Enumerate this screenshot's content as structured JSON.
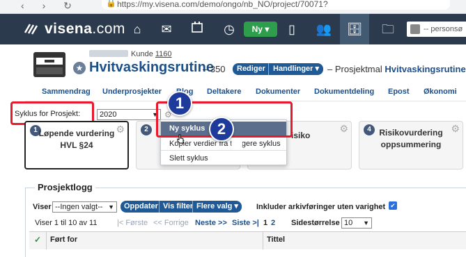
{
  "browser": {
    "url": "https://my.visena.com/demo/ongo/nb_NO/project/70071?"
  },
  "header": {
    "logo": "visena",
    "logo_tld": ".com",
    "ny_label": "Ny ▾",
    "person_placeholder": "-- personsø"
  },
  "project": {
    "kunde_label": "Kunde",
    "kunde_number": "1160",
    "title": "Hvitvaskingsrutine",
    "number_text": "– 350",
    "rediger": "Rediger",
    "handlinger": "Handlinger ▾",
    "prosjektmal_prefix": "– Prosjektmal",
    "prosjektmal_name": "Hvitvaskingsrutine"
  },
  "tabs": [
    "Sammendrag",
    "Underprosjekter",
    "Blog",
    "Deltakere",
    "Dokumenter",
    "Dokumentdeling",
    "Epost",
    "Økonomi"
  ],
  "syklus": {
    "label": "Syklus for Prosjekt:",
    "selected": "2020"
  },
  "cards": [
    {
      "num": "1",
      "title": "Løpende vurdering HVL §24"
    },
    {
      "num": "2",
      "title": ""
    },
    {
      "num": "3",
      "title": "isiko"
    },
    {
      "num": "4",
      "title": "Risikovurdering oppsummering"
    }
  ],
  "menu": {
    "items": [
      "Ny syklus",
      "Kopier verdier fra tidligere syklus",
      "Slett syklus"
    ]
  },
  "annotations": {
    "step1": "1",
    "step2": "2"
  },
  "log": {
    "title": "Prosjektlogg",
    "viser_label": "Viser",
    "filter_selected": "--Ingen valgt--",
    "oppdater": "Oppdater",
    "vis_filter": "Vis filter",
    "flere_valg": "Flere valg ▾",
    "inkluder": "Inkluder arkivføringer uten varighet",
    "count_text": "Viser 1 til 10 av 11",
    "forste": "|< Første",
    "forrige": "<< Forrige",
    "neste": "Neste >>",
    "siste": "Siste >|",
    "page1": "1",
    "page2": "2",
    "sidestorrelse": "Sidestørrelse",
    "page_size": "10",
    "col_fort_for": "Ført for",
    "col_tittel": "Tittel"
  },
  "colors": {
    "header_bg": "#2b3a4c",
    "accent_blue": "#1b4f8a",
    "green": "#2e9e4d",
    "highlight": "#e8192c",
    "badge": "#1e3a9b"
  }
}
